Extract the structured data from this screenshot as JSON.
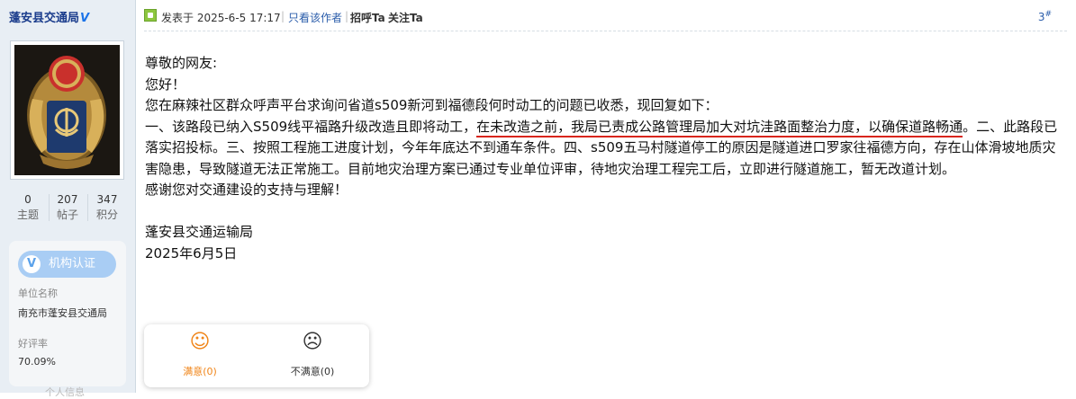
{
  "sidebar": {
    "username": "蓬安县交通局",
    "verified_mark": "V",
    "stats": [
      {
        "value": "0",
        "label": "主题"
      },
      {
        "value": "207",
        "label": "帖子"
      },
      {
        "value": "347",
        "label": "积分"
      }
    ],
    "cert_button": "机构认证",
    "cert_icon": "V",
    "unit_label": "单位名称",
    "unit_value": "南充市蓬安县交通局",
    "rating_label": "好评率",
    "rating_value": "70.09%",
    "faded_text": "个人信息"
  },
  "post": {
    "posted_at": "发表于 2025-6-5 17:17",
    "separator": "|",
    "only_author": "只看该作者",
    "greet": "招呼Ta",
    "follow": "关注Ta",
    "floor": "3",
    "floor_mark": "#",
    "body": {
      "salutation": "尊敬的网友:",
      "hello": "您好！",
      "intro": "您在麻辣社区群众呼声平台求询问省道s509新河到福德段何时动工的问题已收悉，现回复如下：",
      "p1_before": "一、该路段已纳入S509线平福路升级改造且即将动工，",
      "p1_underlined": "在未改造之前，我局已责成公路管理局加大对坑洼路面整治力度，以确保道路畅通",
      "p1_after": "。二、此路段已落实招投标。三、按照工程施工进度计划，今年年底达不到通车条件。四、s509五马村隧道停工的原因是隧道进口罗家往福德方向，存在山体滑坡地质灾害隐患，导致隧道无法正常施工。目前地灾治理方案已通过专业单位评审，待地灾治理工程完工后，立即进行隧道施工，暂无改道计划。",
      "thanks": "感谢您对交通建设的支持与理解！",
      "signature": "蓬安县交通运输局",
      "date": "2025年6月5日"
    }
  },
  "rating_box": {
    "satisfied": "满意(0)",
    "dissatisfied": "不满意(0)"
  },
  "colors": {
    "sidebar_bg": "#e8eef4",
    "link_blue": "#2a5caa",
    "underline_red": "#d9251c",
    "satisfied_orange": "#f08519",
    "cert_blue": "#a9cdf4"
  }
}
